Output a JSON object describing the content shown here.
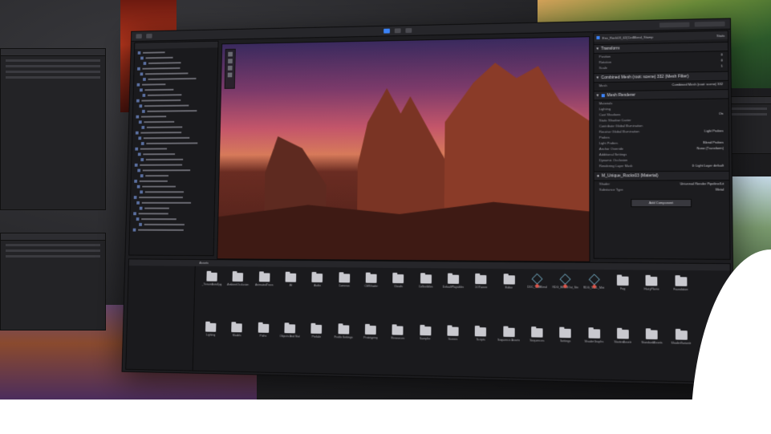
{
  "project": {
    "header": "Assets",
    "assets_row1": [
      {
        "name": "_TerrainAutoUpg",
        "kind": "folder"
      },
      {
        "name": "AmbientOcclusion",
        "kind": "folder"
      },
      {
        "name": "AnimatedTrees",
        "kind": "folder"
      },
      {
        "name": "AI",
        "kind": "folder"
      },
      {
        "name": "Audio",
        "kind": "folder"
      },
      {
        "name": "Cameras",
        "kind": "folder"
      },
      {
        "name": "CliffShader",
        "kind": "folder"
      },
      {
        "name": "Clouds",
        "kind": "folder"
      },
      {
        "name": "Collectibles",
        "kind": "folder"
      },
      {
        "name": "DefaultPlayables",
        "kind": "folder"
      },
      {
        "name": "DOTween",
        "kind": "folder"
      },
      {
        "name": "Editor",
        "kind": "folder"
      },
      {
        "name": "DDC_WBBlend",
        "kind": "prefab"
      },
      {
        "name": "RDG_BlendOut_Ste",
        "kind": "prefab"
      },
      {
        "name": "RDG_WBL_Mist",
        "kind": "prefab"
      },
      {
        "name": "Fog",
        "kind": "folder"
      },
      {
        "name": "HairyPlants",
        "kind": "folder"
      },
      {
        "name": "Foundation",
        "kind": "folder"
      }
    ],
    "assets_row2": [
      {
        "name": "Lighting",
        "kind": "folder"
      },
      {
        "name": "Models",
        "kind": "folder"
      },
      {
        "name": "Paths",
        "kind": "folder"
      },
      {
        "name": "Objects And Stat",
        "kind": "folder"
      },
      {
        "name": "Prefabs",
        "kind": "folder"
      },
      {
        "name": "Profile Settings",
        "kind": "folder"
      },
      {
        "name": "Prototyping",
        "kind": "folder"
      },
      {
        "name": "Resources",
        "kind": "folder"
      },
      {
        "name": "Samples",
        "kind": "folder"
      },
      {
        "name": "Scenes",
        "kind": "folder"
      },
      {
        "name": "Scripts",
        "kind": "folder"
      },
      {
        "name": "Sequence Assets",
        "kind": "folder"
      },
      {
        "name": "Sequences",
        "kind": "folder"
      },
      {
        "name": "Settings",
        "kind": "folder"
      },
      {
        "name": "ShaderGraphs",
        "kind": "folder"
      },
      {
        "name": "StarterAssets",
        "kind": "folder"
      },
      {
        "name": "StandardAssets",
        "kind": "folder"
      },
      {
        "name": "ShaderVariants",
        "kind": "folder"
      }
    ]
  },
  "inspector": {
    "object_name": "Env_Rock03_02(CeilBlend_Stamp",
    "static_label": "Static",
    "transform_title": "Transform",
    "rows_transform": [
      {
        "label": "Position",
        "value": "0"
      },
      {
        "label": "Rotation",
        "value": "0"
      },
      {
        "label": "Scale",
        "value": "1"
      }
    ],
    "mesh_filter_title": "Combined Mesh (root: scene) 332 (Mesh Filter)",
    "mesh_label": "Mesh",
    "mesh_value": "Combined Mesh (root: scene) 332",
    "mesh_renderer_title": "Mesh Renderer",
    "renderer_rows": [
      {
        "label": "Materials",
        "value": ""
      },
      {
        "label": "Lighting",
        "value": ""
      },
      {
        "label": "Cast Shadows",
        "value": "On"
      },
      {
        "label": "Static Shadow Caster",
        "value": ""
      },
      {
        "label": "Contribute Global Illumination",
        "value": ""
      },
      {
        "label": "Receive Global Illumination",
        "value": "Light Probes"
      },
      {
        "label": "Probes",
        "value": ""
      },
      {
        "label": "Light Probes",
        "value": "Blend Probes"
      },
      {
        "label": "Anchor Override",
        "value": "None (Transform)"
      },
      {
        "label": "Additional Settings",
        "value": ""
      },
      {
        "label": "Dynamic Occlusion",
        "value": ""
      },
      {
        "label": "Rendering Layer Mask",
        "value": "0: Light Layer default"
      }
    ],
    "material_title": "M_Unique_Rocks03 (Material)",
    "shader_label": "Shader",
    "shader_value": "Universal Render Pipeline/Lit",
    "substance_label": "Substance Type",
    "substance_value": "Metal",
    "add_component": "Add Component"
  },
  "colors": {
    "accent": "#3b82f6",
    "panel": "#1d1d20",
    "folder": "#c9c9cf"
  }
}
